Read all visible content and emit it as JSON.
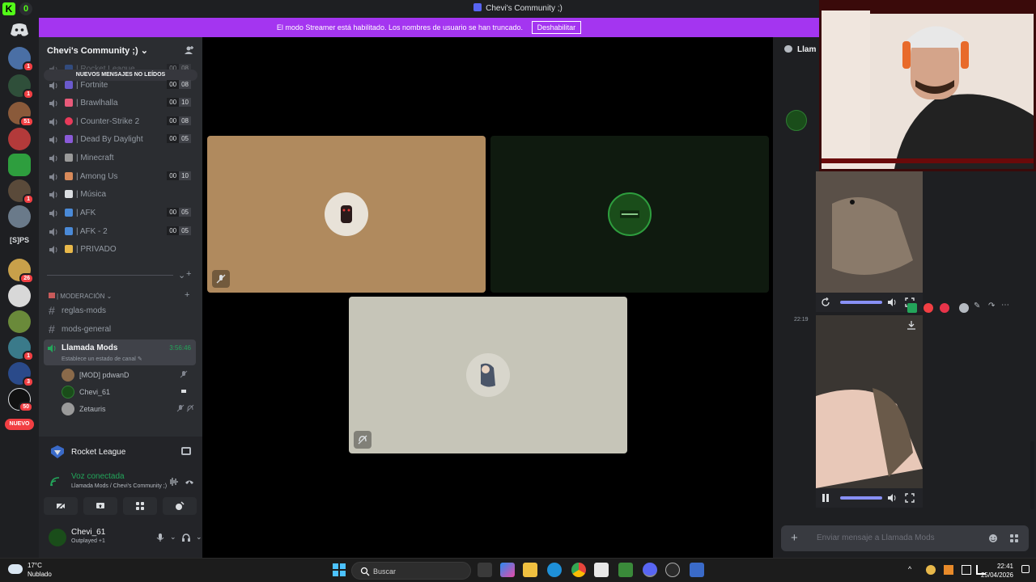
{
  "window": {
    "title": "Chevi's Community ;)"
  },
  "rail": {
    "new_label": "NUEVO",
    "text_server": "[S]PS",
    "badges": [
      "1",
      "1",
      "51",
      "1",
      "26",
      "1",
      "3",
      "50"
    ]
  },
  "banner": {
    "text": "El modo Streamer está habilitado. Los nombres de usuario se han truncado.",
    "button": "Deshabilitar"
  },
  "sidebar": {
    "guild_name": "Chevi's Community ;)",
    "unread_pill": "NUEVOS MENSAJES NO LEÍDOS",
    "voice_channels": [
      {
        "name": "| Rocket League",
        "count": [
          "00",
          "08"
        ]
      },
      {
        "name": "| Fortnite",
        "count": [
          "00",
          "08"
        ]
      },
      {
        "name": "| Brawlhalla",
        "count": [
          "00",
          "10"
        ]
      },
      {
        "name": "| Counter-Strike 2",
        "count": [
          "00",
          "08"
        ]
      },
      {
        "name": "| Dead By Daylight",
        "count": [
          "00",
          "05"
        ]
      },
      {
        "name": "| Minecraft",
        "count": [
          "",
          ""
        ]
      },
      {
        "name": "| Among Us",
        "count": [
          "00",
          "10"
        ]
      },
      {
        "name": "| Música",
        "count": [
          "",
          ""
        ]
      },
      {
        "name": "| AFK",
        "count": [
          "00",
          "05"
        ]
      },
      {
        "name": "| AFK - 2",
        "count": [
          "00",
          "05"
        ]
      },
      {
        "name": "| PRIVADO",
        "count": [
          "",
          ""
        ]
      }
    ],
    "category": "| MODERACIÓN",
    "text_channels": [
      "reglas-mods",
      "mods-general"
    ],
    "active_channel": {
      "name": "Llamada Mods",
      "status": "Establece un estado de canal",
      "timer": "3:56:46"
    },
    "members": [
      "[MOD] pdwanD",
      "Chevi_61",
      "Zetauris"
    ]
  },
  "panel": {
    "game": "Rocket League",
    "voice_status": "Voz conectada",
    "voice_location": "Llamada Mods / Chevi's Community ;)",
    "user_name": "Chevi_61",
    "user_status": "Outplayed +1"
  },
  "chat": {
    "channel_title": "Llam",
    "timestamp": "22:19",
    "input_placeholder": "Enviar mensaje a Llamada Mods"
  },
  "taskbar": {
    "temp": "17°C",
    "weather": "Nublado",
    "search": "Buscar",
    "time": "22:41",
    "date": "25/04/2026"
  },
  "colors": {
    "accent": "#5865f2",
    "streamer_banner": "#a435f0",
    "online": "#23a55a",
    "mention": "#f23f43"
  }
}
